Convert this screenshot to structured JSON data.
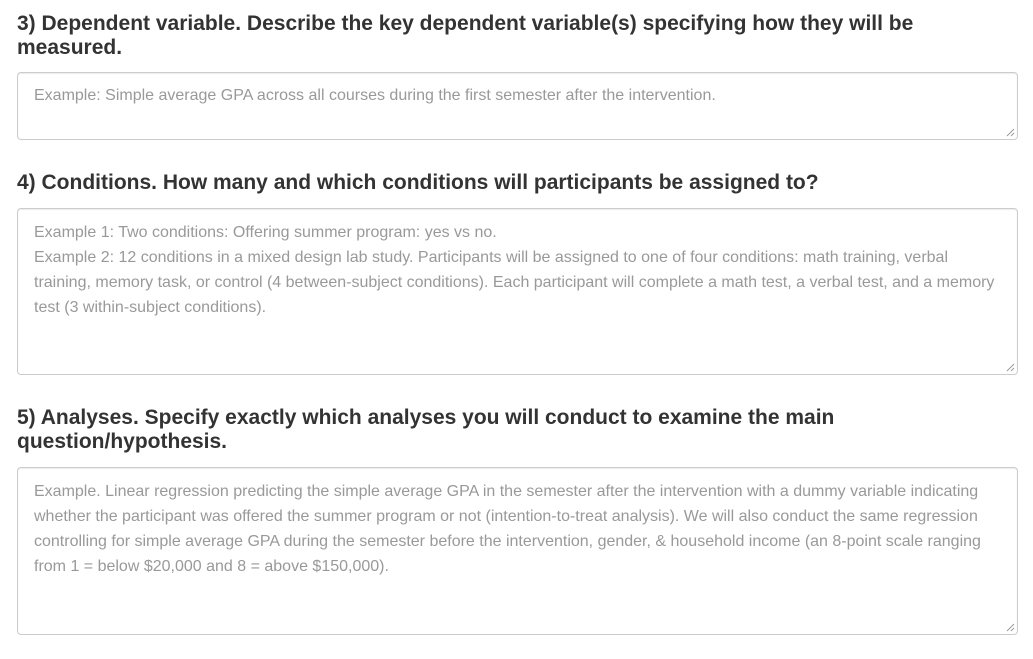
{
  "questions": [
    {
      "number_title": "3) Dependent variable.",
      "prompt": "Describe the key dependent variable(s) specifying how they will be measured.",
      "placeholder_lines": [
        "Example: Simple average GPA across all courses during the first semester after the intervention."
      ]
    },
    {
      "number_title": "4) Conditions.",
      "prompt": "How many and which conditions will participants be assigned to?",
      "placeholder_lines": [
        "Example 1: Two conditions: Offering summer program: yes vs no.",
        "Example 2: 12 conditions in a mixed design lab study. Participants will be assigned to one of four conditions: math training, verbal training, memory task, or control (4 between-subject conditions). Each participant will complete a math test, a verbal test, and a memory test (3 within-subject conditions)."
      ]
    },
    {
      "number_title": "5) Analyses.",
      "prompt": "Specify exactly which analyses you will conduct to examine the main question/hypothesis.",
      "placeholder_lines": [
        "Example. Linear regression predicting the simple average GPA in the semester after the intervention with a dummy variable indicating whether the participant was offered the summer program or not (intention-to-treat analysis). We will also conduct the same regression controlling for simple average GPA during the semester before the intervention, gender, & household income (an 8-point scale ranging from 1 = below $20,000 and 8 = above $150,000)."
      ]
    }
  ],
  "colors": {
    "text": "#333333",
    "placeholder": "#999999",
    "border": "#cccccc"
  },
  "icons": {
    "resize": "resize-grip-icon"
  }
}
